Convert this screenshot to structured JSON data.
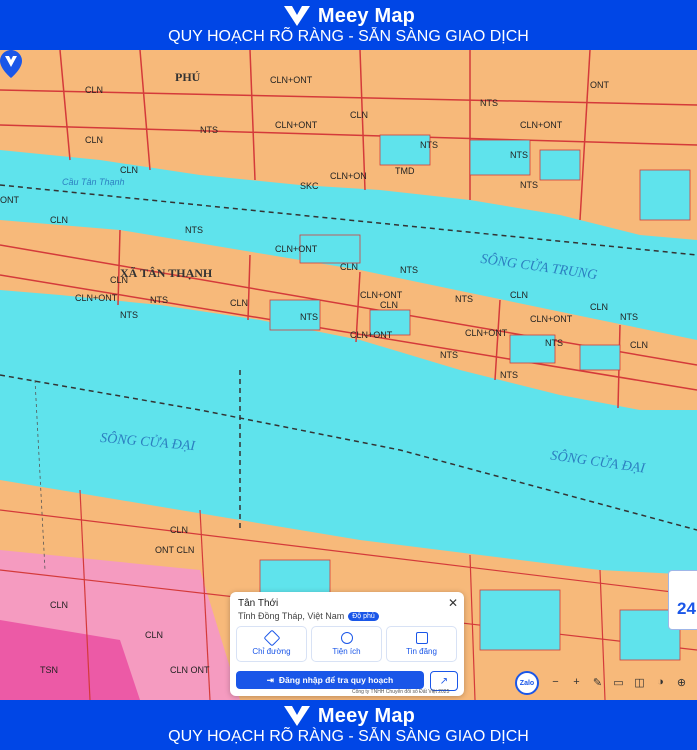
{
  "header": {
    "brand_name": "Meey Map",
    "tagline": "QUY HOẠCH RÕ RÀNG - SẴN SÀNG GIAO DỊCH"
  },
  "footer": {
    "brand_name": "Meey Map",
    "tagline": "QUY HOẠCH RÕ RÀNG - SẴN SÀNG GIAO DỊCH"
  },
  "map": {
    "labels": {
      "town_phu": "PHÚ",
      "town_tan_thanh": "XÃ TÂN THẠNH",
      "river_trung": "SÔNG CỬA TRUNG",
      "river_dai_1": "SÔNG CỬA ĐẠI",
      "river_dai_2": "SÔNG CỬA ĐẠI",
      "bridge": "Cầu Tân Thạnh",
      "side_number": "24"
    },
    "zone_codes": [
      "CLN",
      "CLN+ONT",
      "NTS",
      "ONT",
      "SKC",
      "CLN+ON",
      "TMD",
      "CLN",
      "NTS",
      "CLN+ONT",
      "CLN",
      "NTS",
      "CLN",
      "NTS",
      "CLN+ONT",
      "NTS",
      "ONT",
      "CLN",
      "NTS",
      "CLN+ONT",
      "CLN",
      "NTS",
      "CLN",
      "CLN",
      "NTS",
      "CLN+ONT",
      "NTS",
      "CLN+ONT",
      "CLN",
      "NTS",
      "NTS",
      "CLN",
      "CLN+ONT",
      "NTS",
      "CLN",
      "NTS",
      "CLN+ONT",
      "NTS",
      "CLN+ONT",
      "CLN",
      "NTS",
      "ONT CLN",
      "CLN",
      "CLN",
      "CLN",
      "TSN",
      "CLN ONT",
      "CLN NTS"
    ]
  },
  "info_card": {
    "title": "Tân Thới",
    "address": "Tỉnh Đồng Tháp, Việt Nam",
    "badge": "Độ phủ",
    "actions": [
      {
        "label": "Chỉ đường",
        "icon": "directions-icon"
      },
      {
        "label": "Tiện ích",
        "icon": "amenities-icon"
      },
      {
        "label": "Tin đăng",
        "icon": "listings-icon"
      }
    ],
    "login_button": "Đăng nhập để tra quy hoạch"
  },
  "attribution": "Công ty TNHH Chuyển đổi số Đất Việt 2025",
  "zalo_label": "Zalo",
  "toolbar": [
    "−",
    "+",
    "✎",
    "▭",
    "◫",
    "◑",
    "⊕"
  ],
  "colors": {
    "brand": "#0046e6",
    "river": "#5fe3ec",
    "residential": "#f7b97a",
    "accent": "#1a56e8"
  }
}
